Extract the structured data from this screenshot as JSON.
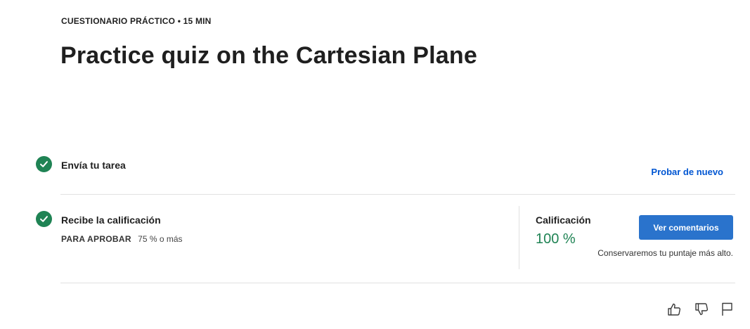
{
  "header": {
    "eyebrow": "CUESTIONARIO PRÁCTICO • 15 MIN",
    "title": "Practice quiz on the Cartesian Plane"
  },
  "steps": [
    {
      "label": "Envía tu tarea",
      "action_label": "Probar de nuevo",
      "icon": "check-circle-icon"
    },
    {
      "label": "Recibe la calificación",
      "pass_label": "PARA APROBAR",
      "pass_value": "75 % o más",
      "icon": "check-circle-icon"
    }
  ],
  "grade": {
    "label": "Calificación",
    "value": "100 %",
    "button_label": "Ver comentarios",
    "note": "Conservaremos tu puntaje más alto."
  },
  "feedback": {
    "icons": [
      "thumbs-up-icon",
      "thumbs-down-icon",
      "flag-icon"
    ]
  },
  "colors": {
    "accent": "#0056d2",
    "button": "#2a73cc",
    "success": "#1f8354",
    "text": "#1f1f1f",
    "divider": "#e1e1e1"
  }
}
